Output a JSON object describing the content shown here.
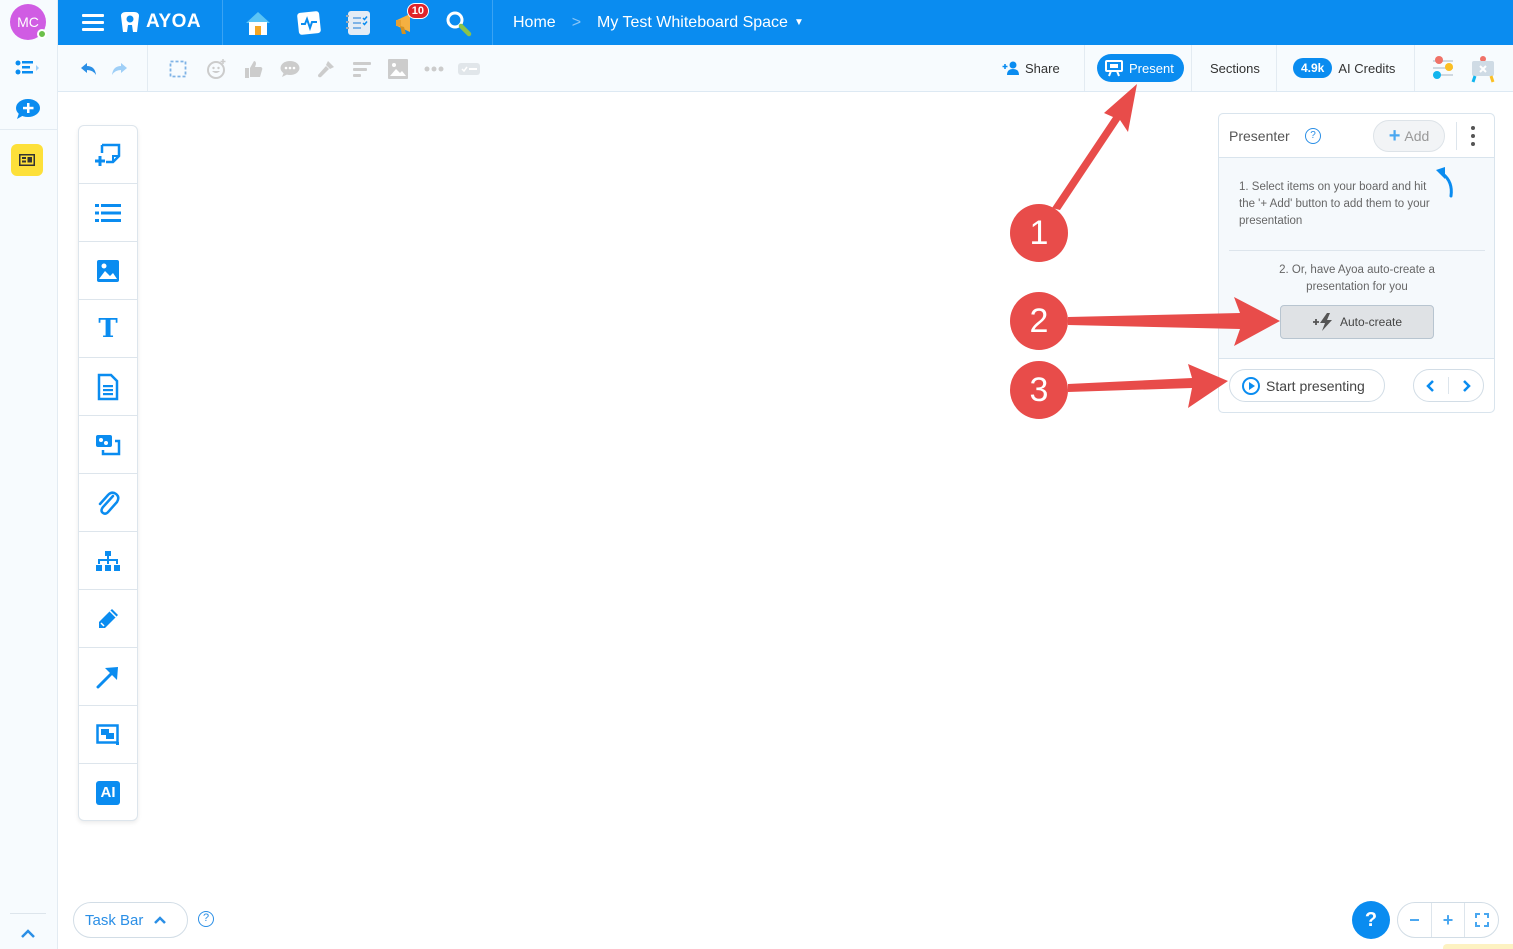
{
  "user": {
    "initials": "MC",
    "status": "online"
  },
  "rail": {
    "icons": [
      "task-list-icon",
      "new-chat-icon",
      "whiteboard-icon",
      "collapse-up-icon"
    ]
  },
  "topbar": {
    "logo_text": "AYOA",
    "app_icons": [
      {
        "name": "home-icon"
      },
      {
        "name": "activity-icon"
      },
      {
        "name": "tasks-icon"
      },
      {
        "name": "notifications-icon",
        "badge": "10"
      },
      {
        "name": "search-icon"
      }
    ],
    "breadcrumb": {
      "home": "Home",
      "separator": ">",
      "current": "My Test Whiteboard Space"
    }
  },
  "toolbar": {
    "share_label": "Share",
    "present_label": "Present",
    "sections_label": "Sections",
    "credits_value": "4.9k",
    "credits_label": "AI Credits"
  },
  "palette": {
    "tools": [
      "add-sticky-note",
      "list",
      "image",
      "text",
      "document",
      "media",
      "attachment",
      "org-chart",
      "pencil",
      "arrow",
      "frame",
      "ai"
    ],
    "ai_label": "AI",
    "text_label": "T"
  },
  "presenter": {
    "title": "Presenter",
    "help": "?",
    "add_label": "Add",
    "step1": "1. Select items on your board and hit the '+ Add' button to add them to your presentation",
    "step2": "2. Or, have Ayoa auto-create a presentation for you",
    "autocreate_label": "Auto-create",
    "start_label": "Start presenting",
    "prev": "<",
    "next": ">"
  },
  "annotations": [
    {
      "number": "1",
      "target": "Present button"
    },
    {
      "number": "2",
      "target": "Auto-create button"
    },
    {
      "number": "3",
      "target": "Start presenting button"
    }
  ],
  "bottom": {
    "taskbar_label": "Task Bar",
    "help": "?",
    "zoom_out": "−",
    "zoom_in": "+",
    "fit": "fit-screen"
  },
  "colors": {
    "brand_blue": "#0a8cf0",
    "annotation_red": "#e84c4a",
    "board_yellow": "#fde03a"
  }
}
